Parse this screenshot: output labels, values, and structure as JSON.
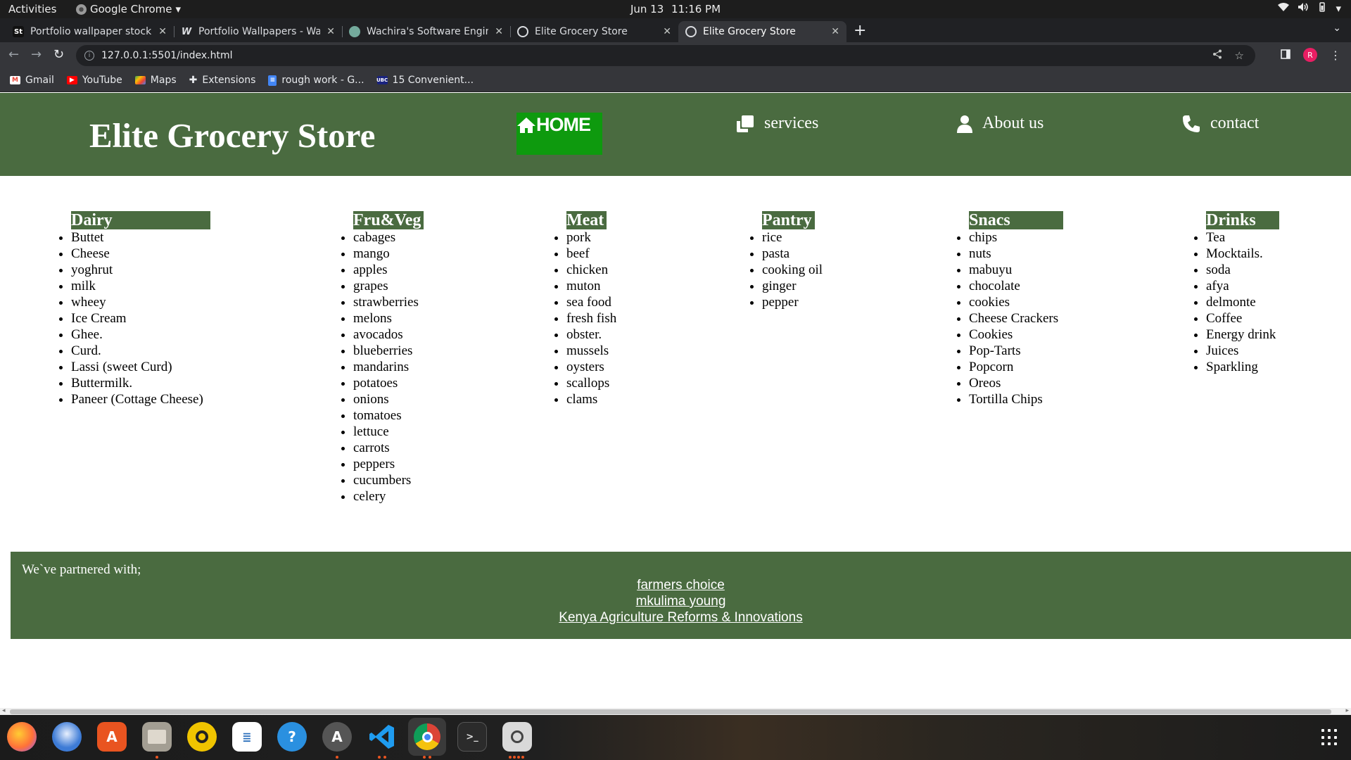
{
  "system": {
    "activities": "Activities",
    "app_name": "Google Chrome",
    "date": "Jun 13",
    "time": "11:16 PM"
  },
  "browser": {
    "tabs": [
      {
        "title": "Portfolio wallpaper stock",
        "favicon": "St",
        "active": false
      },
      {
        "title": "Portfolio Wallpapers - Wa",
        "favicon": "W",
        "active": false
      },
      {
        "title": "Wachira's Software Engin",
        "favicon": "gpt",
        "active": false
      },
      {
        "title": "Elite Grocery Store",
        "favicon": "globe",
        "active": false
      },
      {
        "title": "Elite Grocery Store",
        "favicon": "globe",
        "active": true
      }
    ],
    "url": "127.0.0.1:5501/index.html",
    "bookmarks": [
      "Gmail",
      "YouTube",
      "Maps",
      "Extensions",
      "rough work - G...",
      "15 Convenient..."
    ],
    "profile_initial": "R"
  },
  "site": {
    "title": "Elite Grocery Store",
    "nav": {
      "home": "HOME",
      "services": "services",
      "about": "About us",
      "contact": "contact"
    },
    "categories": [
      {
        "name": "Dairy",
        "items": [
          "Buttet",
          "Cheese",
          "yoghrut",
          "milk",
          "wheey",
          "Ice Cream",
          "Ghee.",
          "Curd.",
          "Lassi (sweet Curd)",
          "Buttermilk.",
          "Paneer (Cottage Cheese)"
        ]
      },
      {
        "name": "Fru&Veg",
        "items": [
          "cabages",
          "mango",
          "apples",
          "grapes",
          "strawberries",
          "melons",
          "avocados",
          "blueberries",
          "mandarins",
          "potatoes",
          "onions",
          "tomatoes",
          "lettuce",
          "carrots",
          "peppers",
          "cucumbers",
          "celery"
        ]
      },
      {
        "name": "Meat",
        "items": [
          "pork",
          "beef",
          "chicken",
          "muton",
          "sea food",
          "fresh fish",
          "obster.",
          "mussels",
          "oysters",
          "scallops",
          "clams"
        ]
      },
      {
        "name": "Pantry",
        "items": [
          "rice",
          "pasta",
          "cooking oil",
          "ginger",
          "pepper"
        ]
      },
      {
        "name": "Snacs",
        "items": [
          "chips",
          "nuts",
          "mabuyu",
          "chocolate",
          "cookies",
          "Cheese Crackers",
          "Cookies",
          "Pop-Tarts",
          "Popcorn",
          "Oreos",
          "Tortilla Chips"
        ]
      },
      {
        "name": "Drinks",
        "items": [
          "Tea",
          "Mocktails.",
          "soda",
          "afya",
          "delmonte",
          "Coffee",
          "Energy drink",
          "Juices",
          "Sparkling"
        ]
      }
    ],
    "partners": {
      "label": "We`ve partnered with;",
      "links": [
        "farmers choice",
        "mkulima young",
        "Kenya Agriculture Reforms & Innovations"
      ]
    }
  },
  "dock": [
    "firefox-icon",
    "thunderbird-icon",
    "software-center-icon",
    "files-icon",
    "rhythmbox-icon",
    "writer-icon",
    "help-icon",
    "updater-icon",
    "vscode-icon",
    "chrome-icon",
    "terminal-icon",
    "screenshot-icon"
  ]
}
